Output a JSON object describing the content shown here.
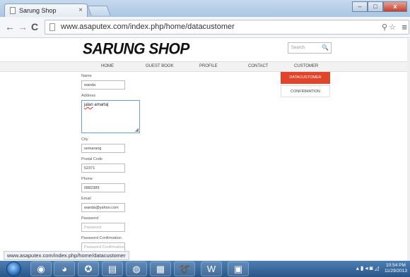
{
  "browser": {
    "tab_title": "Sarung Shop",
    "tab_close": "×",
    "back": "←",
    "forward": "→",
    "reload": "C",
    "url": "www.asaputex.com/index.php/home/datacustomer",
    "zoom_icon": "magnifier-icon",
    "star": "☆",
    "menu": "≡",
    "window_buttons": {
      "minimize": "–",
      "maximize": "□",
      "close": "x"
    }
  },
  "site": {
    "logo": "SARUNG SHOP",
    "search_placeholder": "Search",
    "search_icon": "🔍",
    "nav": [
      "HOME",
      "GUEST BOOK",
      "PROFILE",
      "CONTACT",
      "CUSTOMER"
    ],
    "dropdown": [
      "DATACUSTOMER",
      "CONFIRMATION"
    ],
    "accent_color": "#e2442b"
  },
  "form": {
    "name_label": "Name",
    "name_value": "wanda",
    "address_label": "Address",
    "address_value_underlined": "jalan",
    "address_value_rest": " amarta|",
    "city_label": "City",
    "city_value": "semarang",
    "postal_label": "Postal Code",
    "postal_value": "52371",
    "phone_label": "Phone",
    "phone_value": "0882389",
    "email_label": "Email",
    "email_value": "wanda@yahoo.com",
    "password_label": "Password",
    "password_placeholder": "Password",
    "password_confirm_label": "Password Confirmation",
    "password_confirm_placeholder": "Password Confirmation"
  },
  "status_url": "www.asaputex.com/index.php/home/datacustomer",
  "taskbar": {
    "apps": [
      "explorer",
      "media-player",
      "chrome",
      "firefox",
      "folder",
      "browser",
      "network",
      "acrobat",
      "word",
      "document"
    ],
    "clock_time": "10:54 PM",
    "clock_date": "11/29/2013"
  }
}
